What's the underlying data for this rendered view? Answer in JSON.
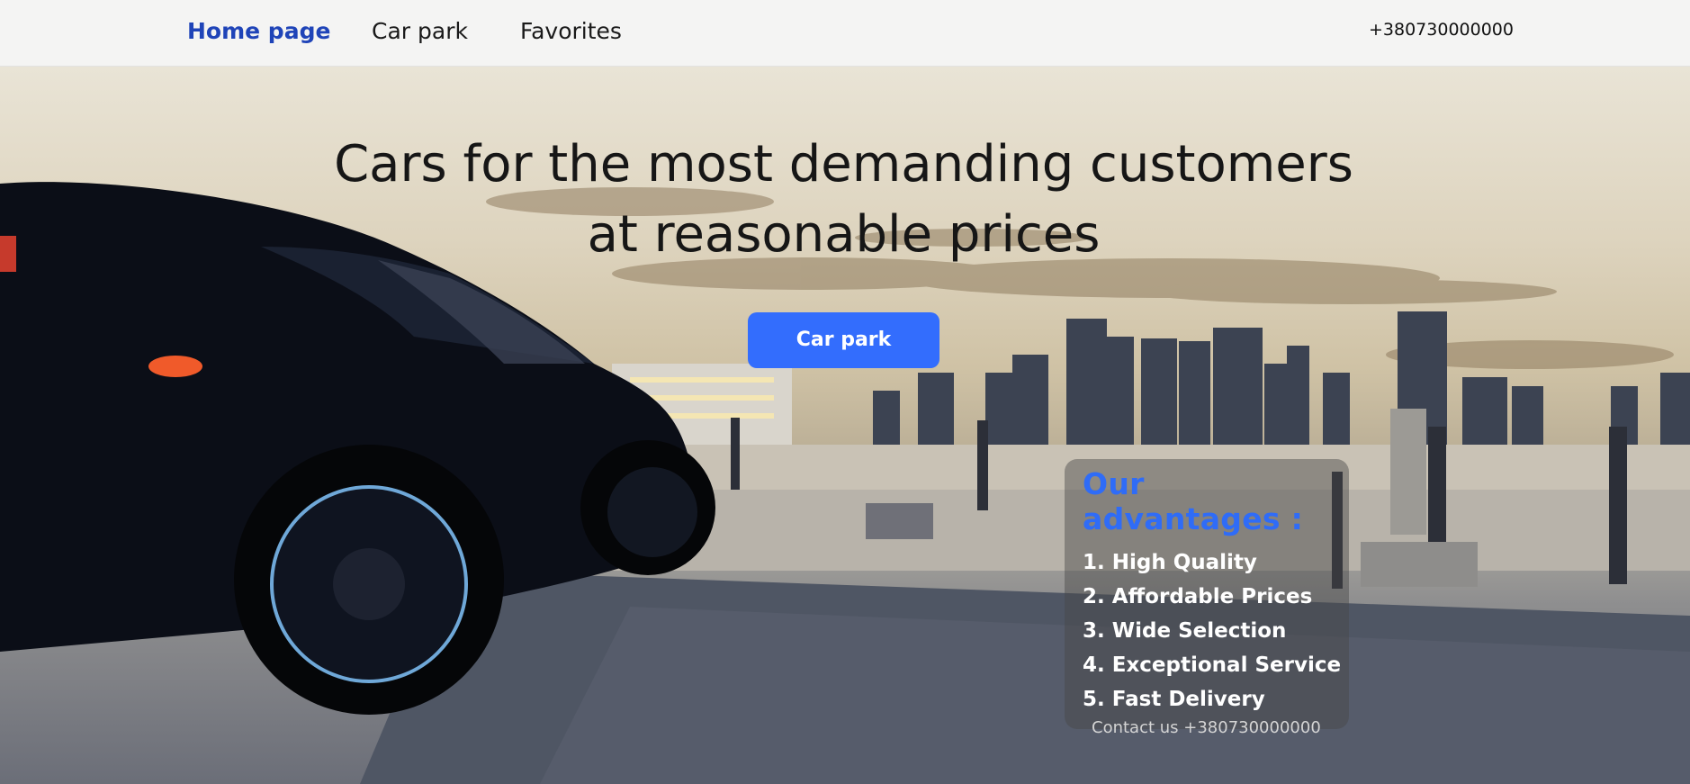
{
  "nav": {
    "items": [
      {
        "label": "Home page",
        "active": true
      },
      {
        "label": "Car park",
        "active": false
      },
      {
        "label": "Favorites",
        "active": false
      }
    ],
    "phone": "+380730000000"
  },
  "hero": {
    "headline_line1": "Cars for the most demanding customers",
    "headline_line2": "at reasonable prices",
    "cta_label": "Car park"
  },
  "advantages": {
    "title": "Our advantages :",
    "items": [
      "1. High Quality",
      "2. Affordable Prices",
      "3. Wide Selection",
      "4. Exceptional Service",
      "5. Fast Delivery"
    ],
    "contact": "Contact us +380730000000"
  },
  "colors": {
    "nav_active": "#1f44b8",
    "nav_bg": "#f4f4f3",
    "button": "#336dfd",
    "advantages_title": "#2f6cf7"
  },
  "icons": {
    "hero_image": "black-sports-car-city-skyline-photo"
  }
}
